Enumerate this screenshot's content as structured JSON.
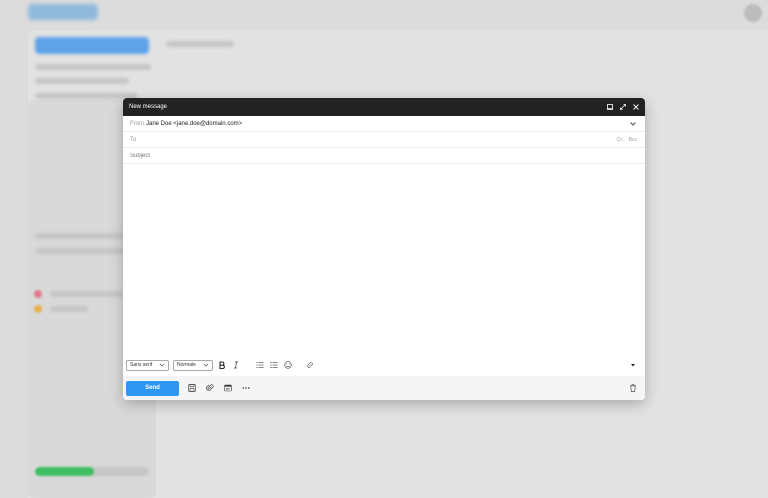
{
  "compose": {
    "title": "New message",
    "from": {
      "label": "From",
      "value": "Jane Doe <jane.doe@domain.com>"
    },
    "to": {
      "label": "To",
      "value": "",
      "cc_label": "Cc",
      "bcc_label": "Bcc"
    },
    "subject": {
      "label": "Subject",
      "value": ""
    },
    "body": "",
    "format": {
      "font_family": "Sans serif",
      "font_size": "Normale"
    },
    "send_label": "Send"
  },
  "icons": {
    "window_controls": [
      "minimize-icon",
      "expand-icon",
      "close-icon"
    ],
    "format": [
      "bold-icon",
      "italic-icon",
      "bulleted-list-icon",
      "numbered-list-icon",
      "emoji-icon",
      "link-icon",
      "more-formatting-icon"
    ],
    "actions": [
      "save-icon",
      "attach-icon",
      "template-icon",
      "more-options-icon",
      "delete-icon"
    ]
  },
  "colors": {
    "titlebar": "#222222",
    "send_button": "#2e97f2",
    "overlay": "#d4d4d4"
  }
}
